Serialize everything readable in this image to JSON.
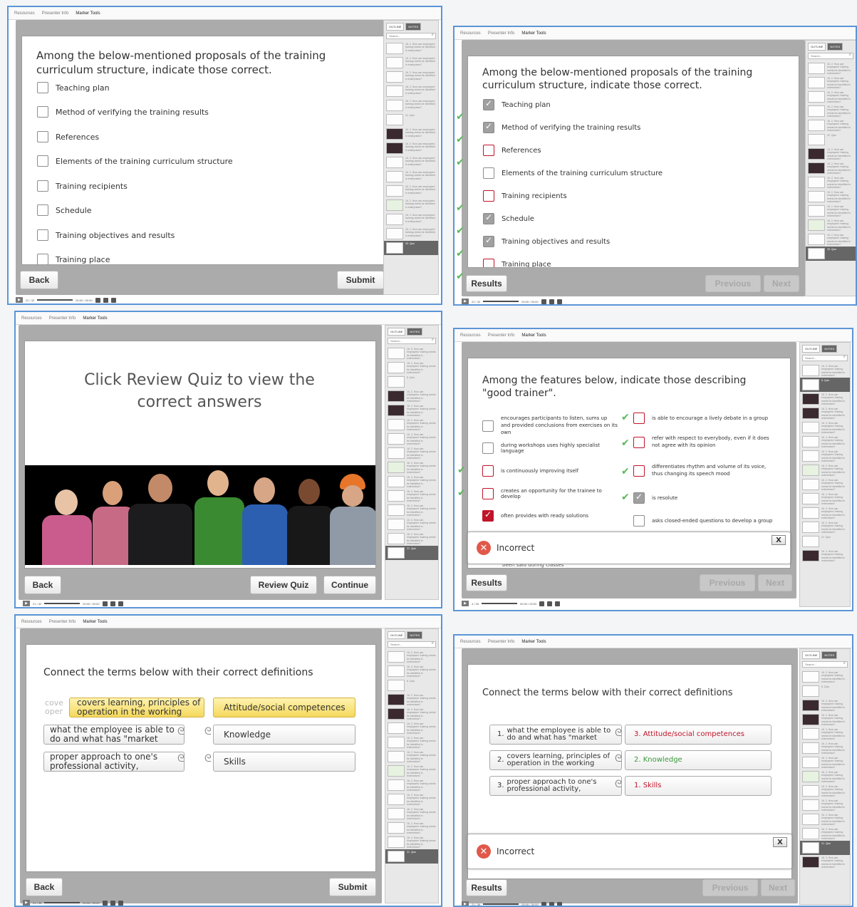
{
  "top_tabs": [
    "Resources",
    "Presenter Info",
    "Marker Tools"
  ],
  "sidebar": {
    "tab_outline": "OUTLINE",
    "tab_notes": "NOTES",
    "search_placeholder": "Search...",
    "item_text": "16. 2. How can employees' training needs be identified in enterprises?",
    "quiz_label": "33. Quiz",
    "quiz_label_b": "22. Quiz",
    "quiz_label_c": "8. Quiz",
    "quiz_label_d": "21. Quiz"
  },
  "player": {
    "time_a": "22 / 32",
    "time_b": "00:00 / 00:00",
    "time_c": "21 / 32",
    "time_d": "4 / 35",
    "time_e": "21 / 35",
    "time_f": "21 / 36"
  },
  "q1": {
    "title": "Among the below-mentioned proposals of the training curriculum structure, indicate those correct.",
    "options": [
      "Teaching plan",
      "Method of verifying the training results",
      "References",
      "Elements of the training curriculum structure",
      "Training recipients",
      "Schedule",
      "Training objectives and results",
      "Training place"
    ]
  },
  "buttons": {
    "back": "Back",
    "submit": "Submit",
    "results": "Results",
    "previous": "Previous",
    "next": "Next",
    "review_quiz": "Review Quiz",
    "continue": "Continue"
  },
  "review": {
    "message": "Click Review Quiz to view the correct answers"
  },
  "q2": {
    "title": "Among the features below, indicate those describing \"good trainer\".",
    "left_options": [
      "encourages participants to listen, sums up and provided conclusions from exercises on its own",
      "during workshops uses highly specialist language",
      "is continuously improving itself",
      "creates an opportunity for the trainee to develop",
      "often provides with ready solutions"
    ],
    "right_options": [
      "is able to encourage a lively debate in a group",
      "refer with respect to everybody, even if it does not agree with its opinion",
      "differentiates rhythm and volume of its voice, thus changing its speech mood",
      "is resolute",
      "asks closed-ended questions to develop a group"
    ],
    "hidden_option_tail": "been said during classes"
  },
  "feedback": {
    "incorrect": "Incorrect",
    "close": "X"
  },
  "q3": {
    "title": "Connect the terms below with their correct definitions",
    "definitions": [
      "covers learning, principles of operation in the working",
      "what the employee is able to do and what has \"market",
      "proper approach to one's professional activity,"
    ],
    "partial_left": "cove oper",
    "terms": [
      "Attitude/social competences",
      "Knowledge",
      "Skills"
    ]
  },
  "q3_result": {
    "rows": [
      {
        "num": "1.",
        "def": "what the employee is able to do and what has \"market",
        "term": "3. Attitude/social competences",
        "color": "#c0142a"
      },
      {
        "num": "2.",
        "def": "covers learning, principles of operation in the working",
        "term": "2. Knowledge",
        "color": "#3a9a3a"
      },
      {
        "num": "3.",
        "def": "proper approach to one's professional activity,",
        "term": "1. Skills",
        "color": "#c0142a"
      }
    ]
  }
}
